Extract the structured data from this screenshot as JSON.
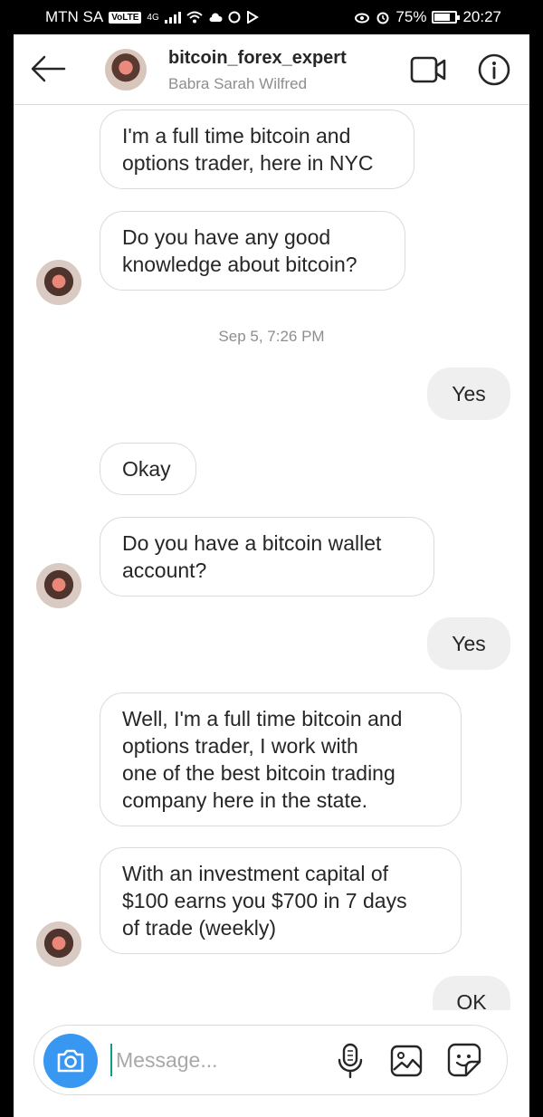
{
  "status_bar": {
    "carrier": "MTN SA",
    "volte": "VoLTE",
    "network": "4G",
    "battery": "75%",
    "battery_level": 0.75,
    "time": "20:27"
  },
  "header": {
    "username": "bitcoin_forex_expert",
    "display_name": "Babra Sarah Wilfred",
    "icons": [
      "arrow-left-icon",
      "video-camera-icon",
      "info-icon"
    ]
  },
  "messages": [
    {
      "from": "them",
      "text": "I'm a full time bitcoin and\noptions trader, here in NYC"
    },
    {
      "from": "them",
      "text": "Do you have any good\nknowledge about bitcoin?"
    },
    {
      "type": "timestamp",
      "text": "Sep 5, 7:26 PM"
    },
    {
      "from": "me",
      "text": "Yes"
    },
    {
      "from": "them",
      "text": "Okay"
    },
    {
      "from": "them",
      "text": "Do you have a bitcoin wallet\naccount?"
    },
    {
      "from": "me",
      "text": "Yes"
    },
    {
      "from": "them",
      "text": "Well, I'm a full time bitcoin and\noptions trader,  I work with\none of the best bitcoin trading\ncompany here in the state."
    },
    {
      "from": "them",
      "text": "With an investment capital of\n$100 earns you $700 in 7 days\nof trade (weekly)"
    },
    {
      "from": "me",
      "text": "OK"
    }
  ],
  "composer": {
    "placeholder": "Message...",
    "value": "",
    "icons": [
      "camera-icon",
      "microphone-icon",
      "gallery-icon",
      "sticker-icon"
    ]
  },
  "colors": {
    "accent": "#3897f0",
    "bubble_border": "#dbdbdb",
    "outgoing_bubble": "#efefef",
    "muted_text": "#8e8e8e"
  }
}
